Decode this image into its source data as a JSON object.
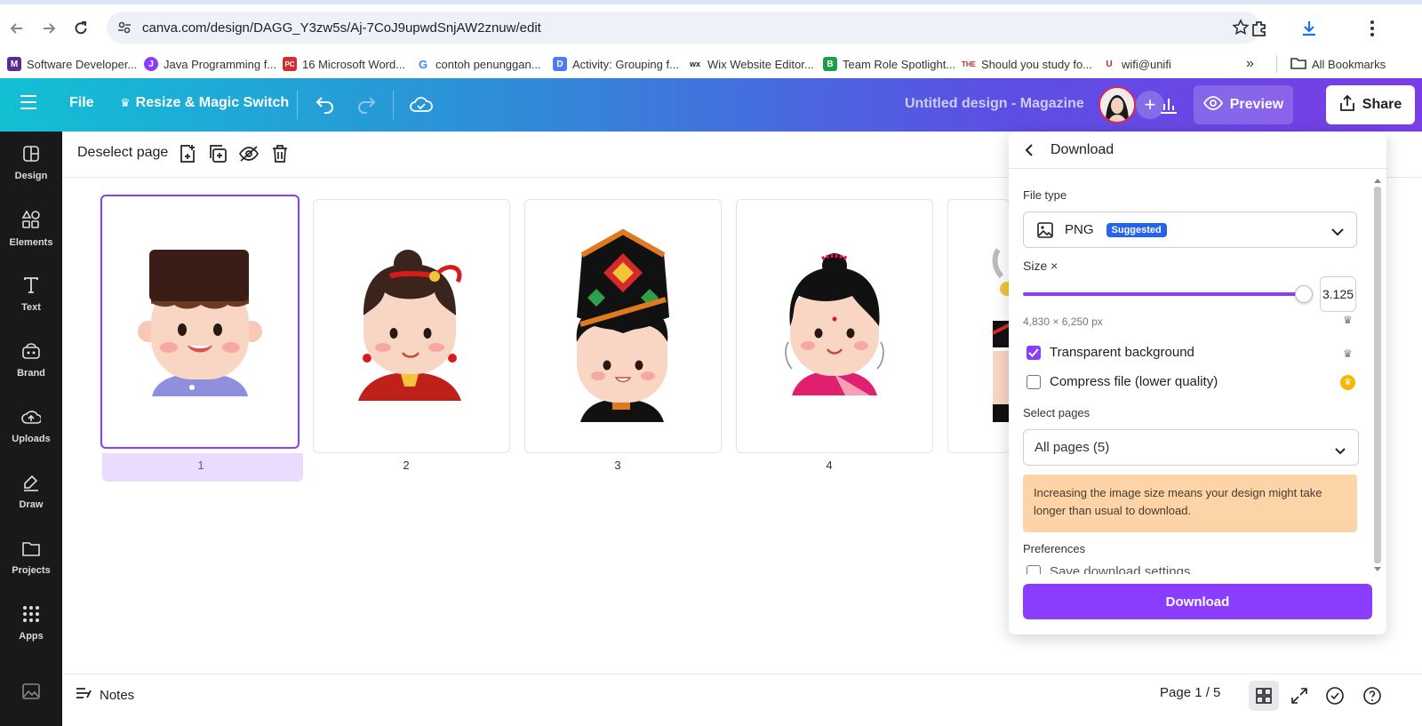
{
  "browser": {
    "url": "canva.com/design/DAGG_Y3zw5s/Aj-7CoJ9upwdSnjAW2znuw/edit",
    "bookmarks": [
      {
        "label": "Software Developer...",
        "icon": "M",
        "color": "#5b2d8e"
      },
      {
        "label": "Java Programming f...",
        "icon": "J",
        "color": "#8b3dff"
      },
      {
        "label": "16 Microsoft Word...",
        "icon": "PC",
        "color": "#d32f2f"
      },
      {
        "label": "contoh penunggan...",
        "icon": "G",
        "color": "#4285f4"
      },
      {
        "label": "Activity: Grouping f...",
        "icon": "D",
        "color": "#4a7df0"
      },
      {
        "label": "Wix Website Editor...",
        "icon": "wx",
        "color": "#222222"
      },
      {
        "label": "Team Role Spotlight...",
        "icon": "B",
        "color": "#1e9e4a"
      },
      {
        "label": "Should you study fo...",
        "icon": "THE",
        "color": "#c62828"
      },
      {
        "label": "wifi@unifi",
        "icon": "U",
        "color": "#c62828"
      }
    ],
    "all_bookmarks": "All Bookmarks"
  },
  "topbar": {
    "file": "File",
    "magic": "Resize & Magic Switch",
    "doc_title": "Untitled design - Magazine",
    "preview": "Preview",
    "share": "Share"
  },
  "rail": [
    {
      "label": "Design",
      "icon": "design-icon"
    },
    {
      "label": "Elements",
      "icon": "elements-icon"
    },
    {
      "label": "Text",
      "icon": "text-icon"
    },
    {
      "label": "Brand",
      "icon": "brand-icon"
    },
    {
      "label": "Uploads",
      "icon": "uploads-icon"
    },
    {
      "label": "Draw",
      "icon": "draw-icon"
    },
    {
      "label": "Projects",
      "icon": "projects-icon"
    },
    {
      "label": "Apps",
      "icon": "apps-icon"
    }
  ],
  "workspace": {
    "deselect": "Deselect page",
    "pages": [
      "1",
      "2",
      "3",
      "4"
    ]
  },
  "footer": {
    "notes": "Notes",
    "page_count": "Page 1 / 5"
  },
  "download": {
    "title": "Download",
    "file_type_label": "File type",
    "file_type": "PNG",
    "suggested": "Suggested",
    "size_label": "Size ×",
    "size_value": "3.125",
    "size_px": "4,830 × 6,250 px",
    "transparent": "Transparent background",
    "transparent_checked": true,
    "compress": "Compress file (lower quality)",
    "compress_checked": false,
    "select_pages_label": "Select pages",
    "select_pages": "All pages (5)",
    "warning": "Increasing the image size means your design might take longer than usual to download.",
    "preferences": "Preferences",
    "save_settings": "Save download settings",
    "button": "Download"
  },
  "colors": {
    "accent": "#8b3dff",
    "warning_bg": "#fdd4a8",
    "badge": "#2563eb"
  }
}
